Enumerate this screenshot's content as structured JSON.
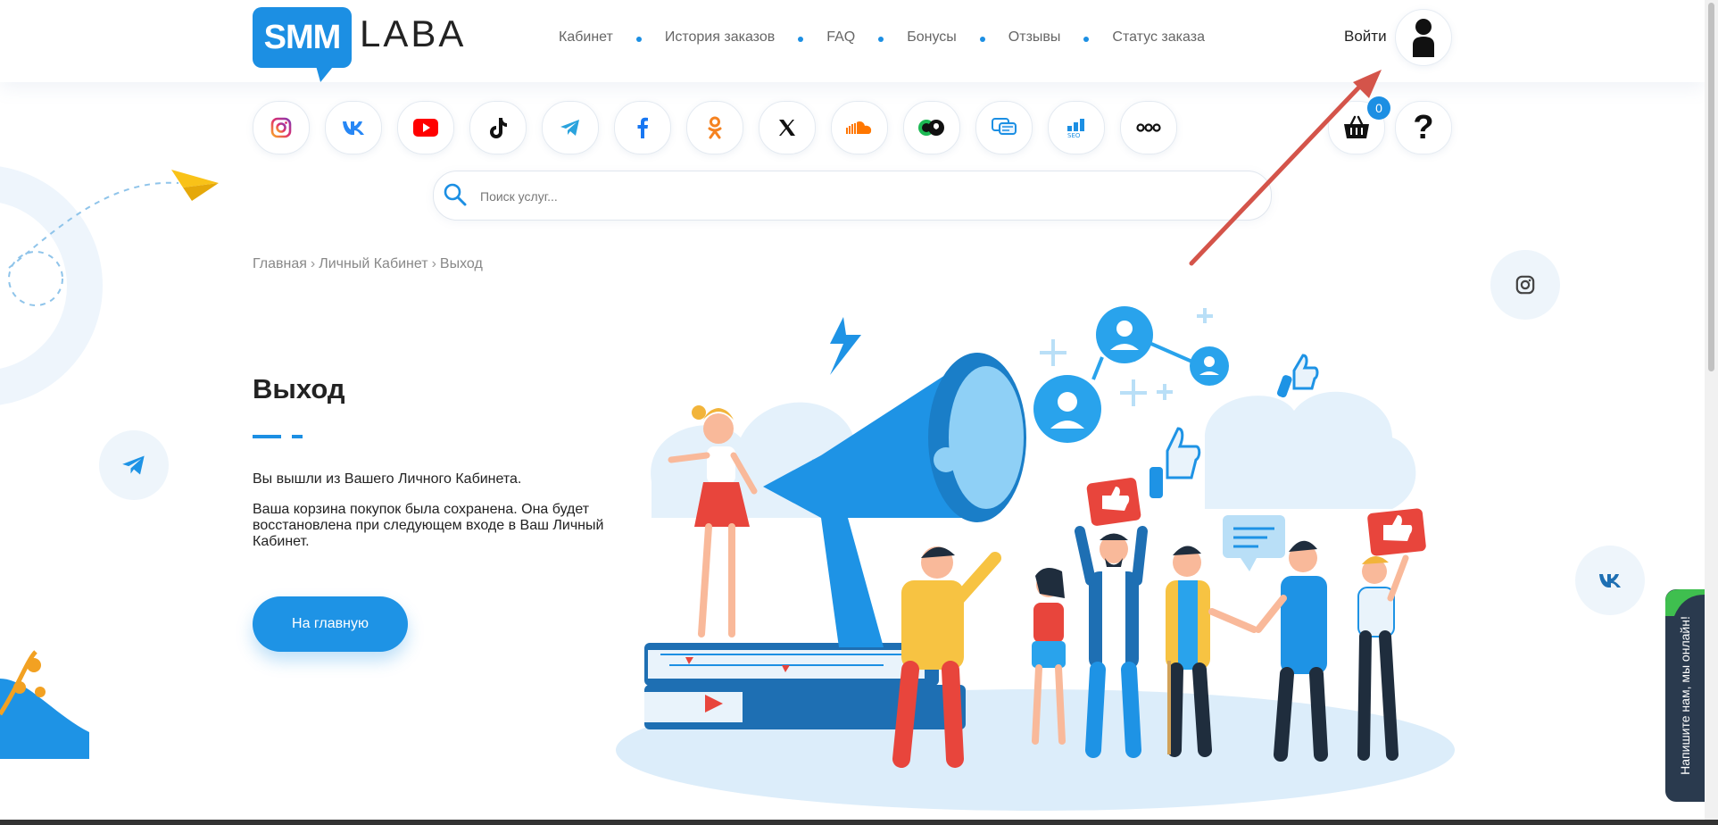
{
  "logo": {
    "left": "SMM",
    "right": "LABA"
  },
  "nav": {
    "items": [
      {
        "label": "Кабинет"
      },
      {
        "label": "История заказов"
      },
      {
        "label": "FAQ"
      },
      {
        "label": "Бонусы"
      },
      {
        "label": "Отзывы"
      },
      {
        "label": "Статус заказа"
      }
    ]
  },
  "header": {
    "login_label": "Войти",
    "help_label": "?",
    "cart_count": "0"
  },
  "social_bar": {
    "items": [
      "instagram-icon",
      "vk-icon",
      "youtube-icon",
      "tiktok-icon",
      "telegram-icon",
      "facebook-icon",
      "odnoklassniki-icon",
      "x-icon",
      "soundcloud-icon",
      "apple-music-icon",
      "chat-icon",
      "seo-icon",
      "more-icon"
    ]
  },
  "search": {
    "placeholder": "Поиск услуг..."
  },
  "breadcrumb": {
    "home": "Главная",
    "sep": "›",
    "account": "Личный Кабинет",
    "current": "Выход"
  },
  "main": {
    "title": "Выход",
    "message1": "Вы вышли из Вашего Личного Кабинета.",
    "message2": "Ваша корзина покупок была сохранена. Она будет восстановлена при следующем входе в Ваш Личный Кабинет.",
    "home_button": "На главную"
  },
  "chat_widget": {
    "label": "Напишите нам, мы онлайн!"
  },
  "colors": {
    "accent": "#1c8fe3",
    "button": "#1e93e5",
    "arrow": "#d9534f",
    "badge": "#1c8fe3"
  }
}
